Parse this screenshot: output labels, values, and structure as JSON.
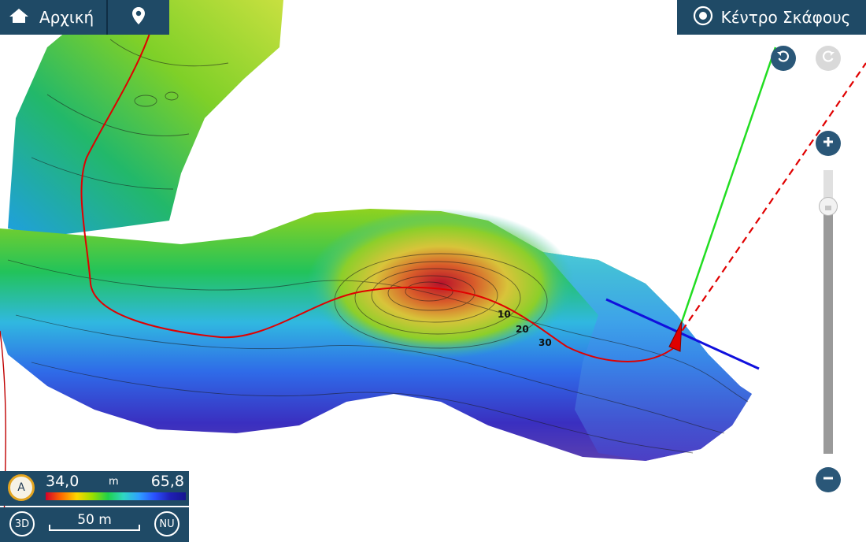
{
  "toolbar": {
    "home_label": "Αρχική",
    "home_icon": "home-icon",
    "location_icon": "map-pin-icon"
  },
  "center_button": {
    "label": "Κέντρο Σκάφους",
    "icon": "target-icon"
  },
  "controls": {
    "undo_icon": "undo-icon",
    "redo_icon": "redo-icon",
    "zoom_in_icon": "plus-icon",
    "zoom_out_icon": "minus-icon"
  },
  "legend": {
    "auto_label": "A",
    "depth_min": "34,0",
    "depth_unit": "m",
    "depth_max": "65,8"
  },
  "scale": {
    "mode_label": "3D",
    "distance_label": "50 m",
    "orientation_label": "NU"
  },
  "map": {
    "depth_labels": [
      "10",
      "20",
      "30"
    ],
    "colors": {
      "track": "#e00000",
      "heading_line": "#22dd22",
      "course_line": "#e00000",
      "beam_line": "#1010dd",
      "vessel": "#e00000"
    }
  }
}
